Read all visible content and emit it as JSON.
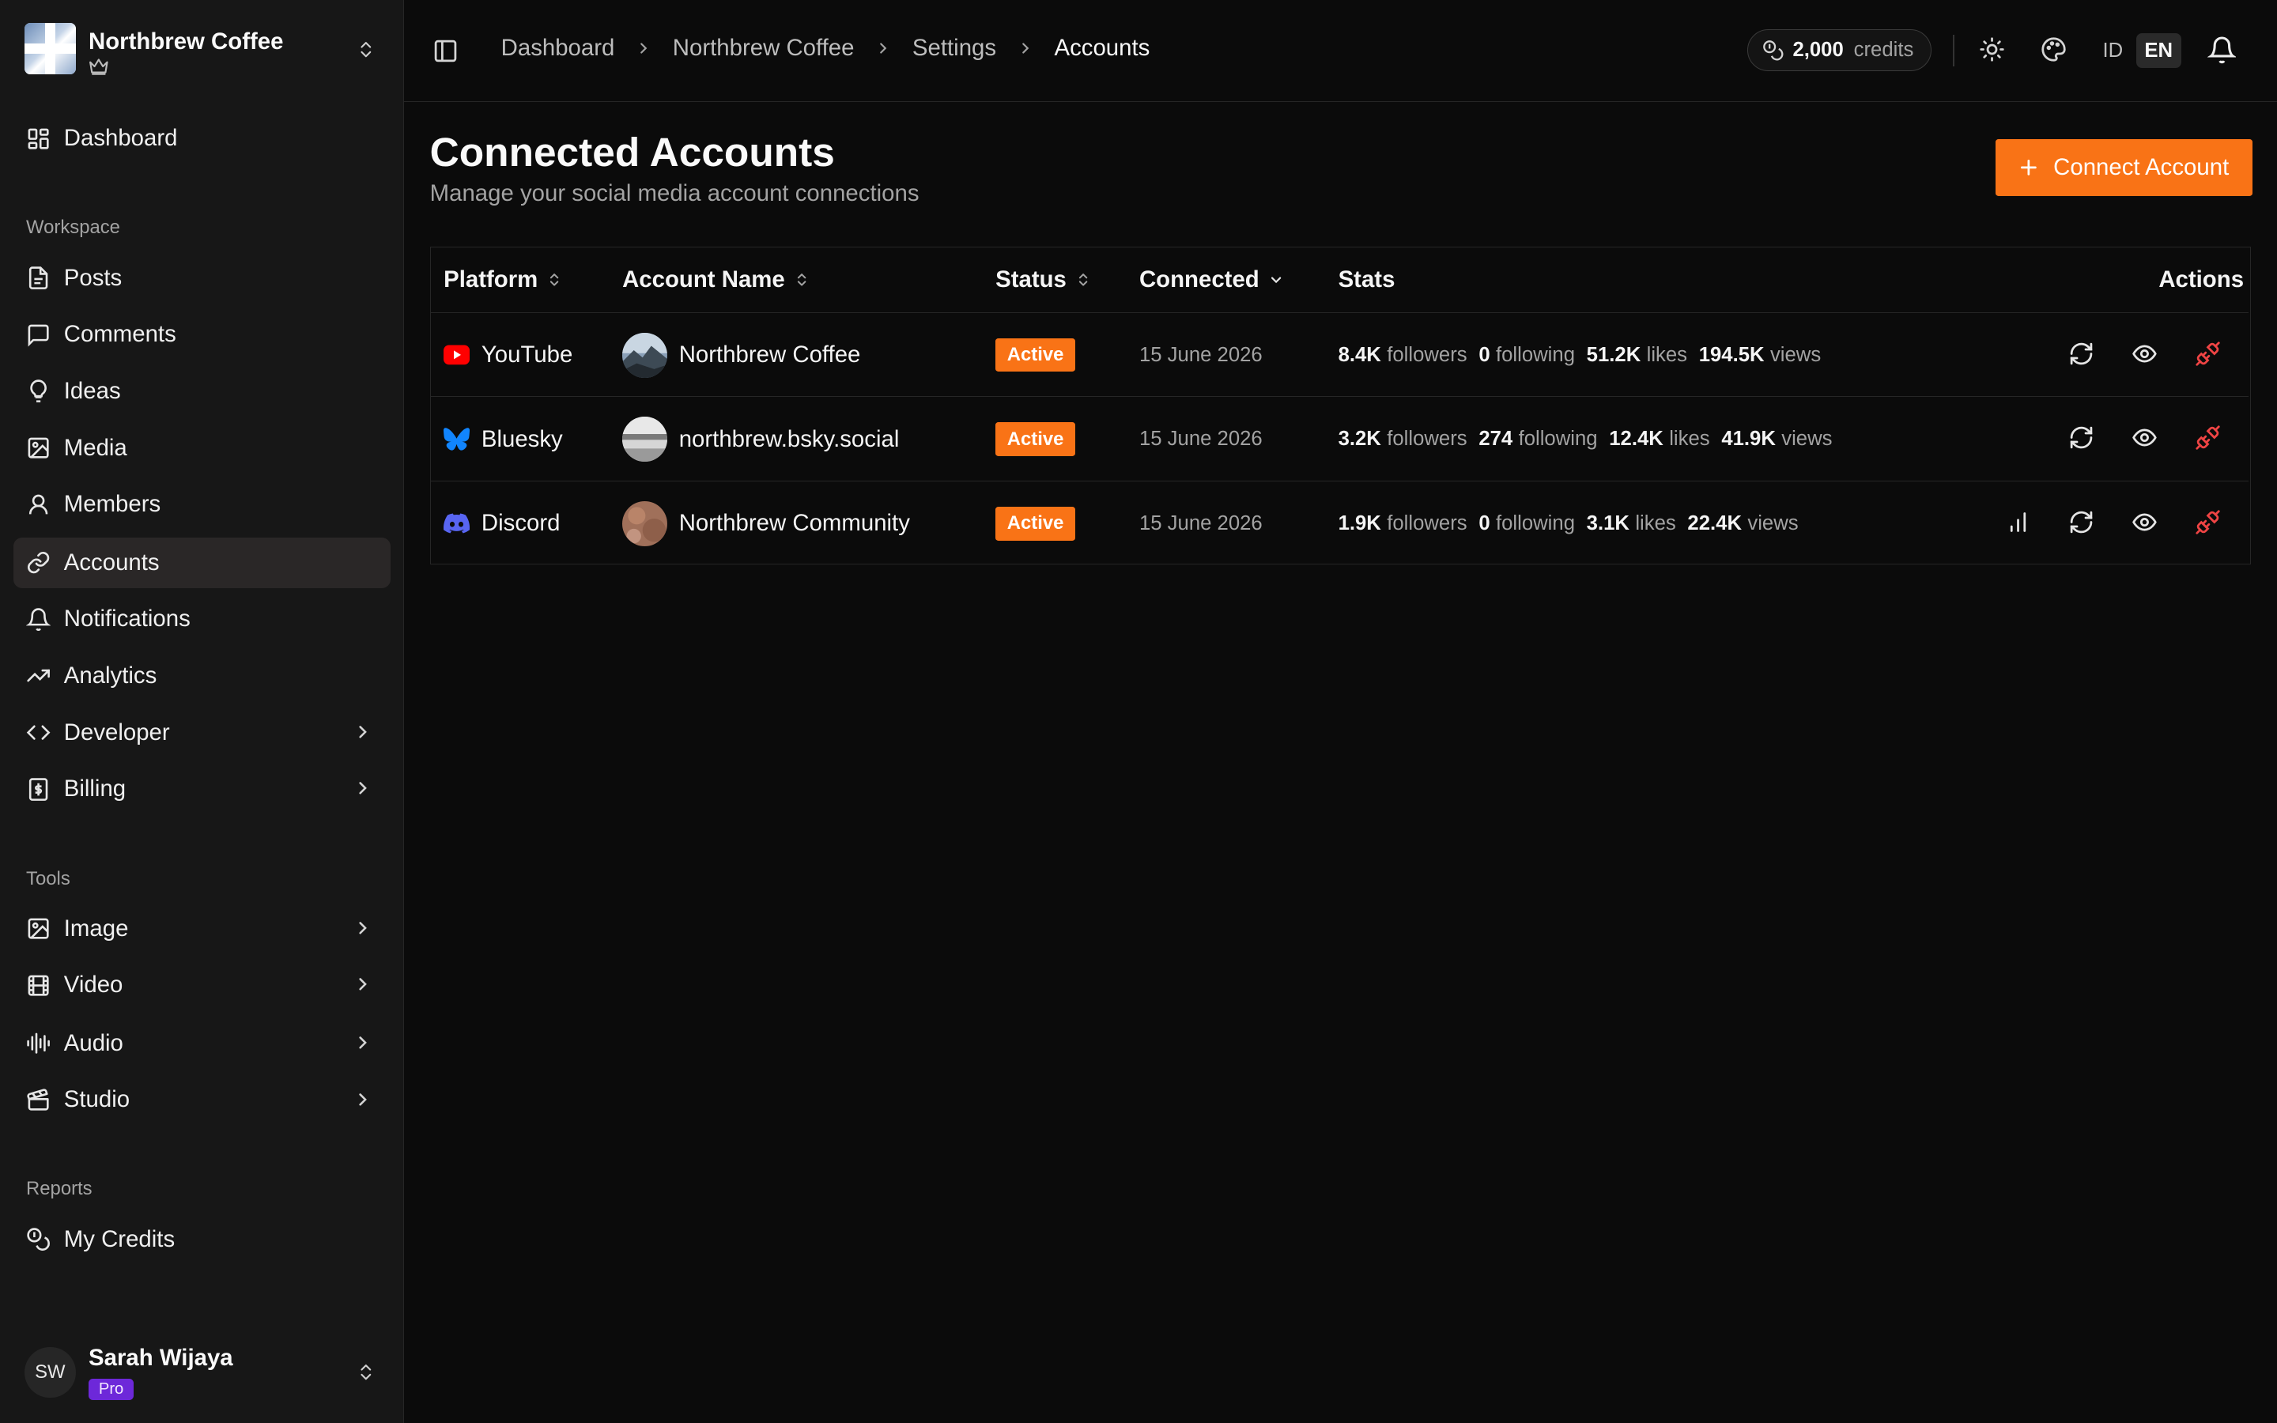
{
  "org": {
    "name": "Northbrew Coffee"
  },
  "sidebar": {
    "top_items": [
      {
        "label": "Dashboard",
        "icon": "dashboard-icon"
      }
    ],
    "sections": [
      {
        "title": "Workspace",
        "items": [
          {
            "label": "Posts",
            "icon": "file-text-icon"
          },
          {
            "label": "Comments",
            "icon": "message-square-icon"
          },
          {
            "label": "Ideas",
            "icon": "lightbulb-icon"
          },
          {
            "label": "Media",
            "icon": "image-icon"
          },
          {
            "label": "Members",
            "icon": "user-icon"
          },
          {
            "label": "Accounts",
            "icon": "link-icon",
            "active": true
          },
          {
            "label": "Notifications",
            "icon": "bell-icon"
          },
          {
            "label": "Analytics",
            "icon": "trending-up-icon"
          },
          {
            "label": "Developer",
            "icon": "code-icon",
            "expandable": true
          },
          {
            "label": "Billing",
            "icon": "receipt-icon",
            "expandable": true
          }
        ]
      },
      {
        "title": "Tools",
        "items": [
          {
            "label": "Image",
            "icon": "image-icon",
            "expandable": true
          },
          {
            "label": "Video",
            "icon": "film-icon",
            "expandable": true
          },
          {
            "label": "Audio",
            "icon": "audio-waveform-icon",
            "expandable": true
          },
          {
            "label": "Studio",
            "icon": "clapperboard-icon",
            "expandable": true
          }
        ]
      },
      {
        "title": "Reports",
        "items": [
          {
            "label": "My Credits",
            "icon": "coins-icon"
          }
        ]
      }
    ]
  },
  "user": {
    "initials": "SW",
    "name": "Sarah Wijaya",
    "plan": "Pro"
  },
  "breadcrumb": [
    "Dashboard",
    "Northbrew Coffee",
    "Settings",
    "Accounts"
  ],
  "header": {
    "credits_value": "2,000",
    "credits_unit": "credits",
    "lang_id": "ID",
    "lang_en": "EN",
    "active_lang": "EN"
  },
  "page": {
    "title": "Connected Accounts",
    "subtitle": "Manage your social media account connections",
    "connect_label": "Connect Account"
  },
  "table": {
    "columns": {
      "platform": "Platform",
      "account": "Account Name",
      "status": "Status",
      "connected": "Connected",
      "stats": "Stats",
      "actions": "Actions"
    },
    "rows": [
      {
        "platform": "YouTube",
        "platform_icon": "youtube-icon",
        "platform_color": "#ff0000",
        "account": "Northbrew Coffee",
        "status": "Active",
        "connected": "15 June 2026",
        "stats": {
          "followers": "8.4K",
          "following": "0",
          "likes": "51.2K",
          "views": "194.5K"
        },
        "actions": [
          "refresh",
          "view",
          "disconnect"
        ]
      },
      {
        "platform": "Bluesky",
        "platform_icon": "bluesky-butterfly-icon",
        "platform_color": "#1185fe",
        "account": "northbrew.bsky.social",
        "status": "Active",
        "connected": "15 June 2026",
        "stats": {
          "followers": "3.2K",
          "following": "274",
          "likes": "12.4K",
          "views": "41.9K"
        },
        "actions": [
          "refresh",
          "view",
          "disconnect"
        ]
      },
      {
        "platform": "Discord",
        "platform_icon": "discord-icon",
        "platform_color": "#5865f2",
        "account": "Northbrew Community",
        "status": "Active",
        "connected": "15 June 2026",
        "stats": {
          "followers": "1.9K",
          "following": "0",
          "likes": "3.1K",
          "views": "22.4K"
        },
        "actions": [
          "analytics",
          "refresh",
          "view",
          "disconnect"
        ]
      }
    ],
    "stat_labels": {
      "followers": "followers",
      "following": "following",
      "likes": "likes",
      "views": "views"
    }
  },
  "colors": {
    "accent": "#f97316",
    "danger": "#ef4444",
    "pro_badge": "#6d28d9"
  }
}
